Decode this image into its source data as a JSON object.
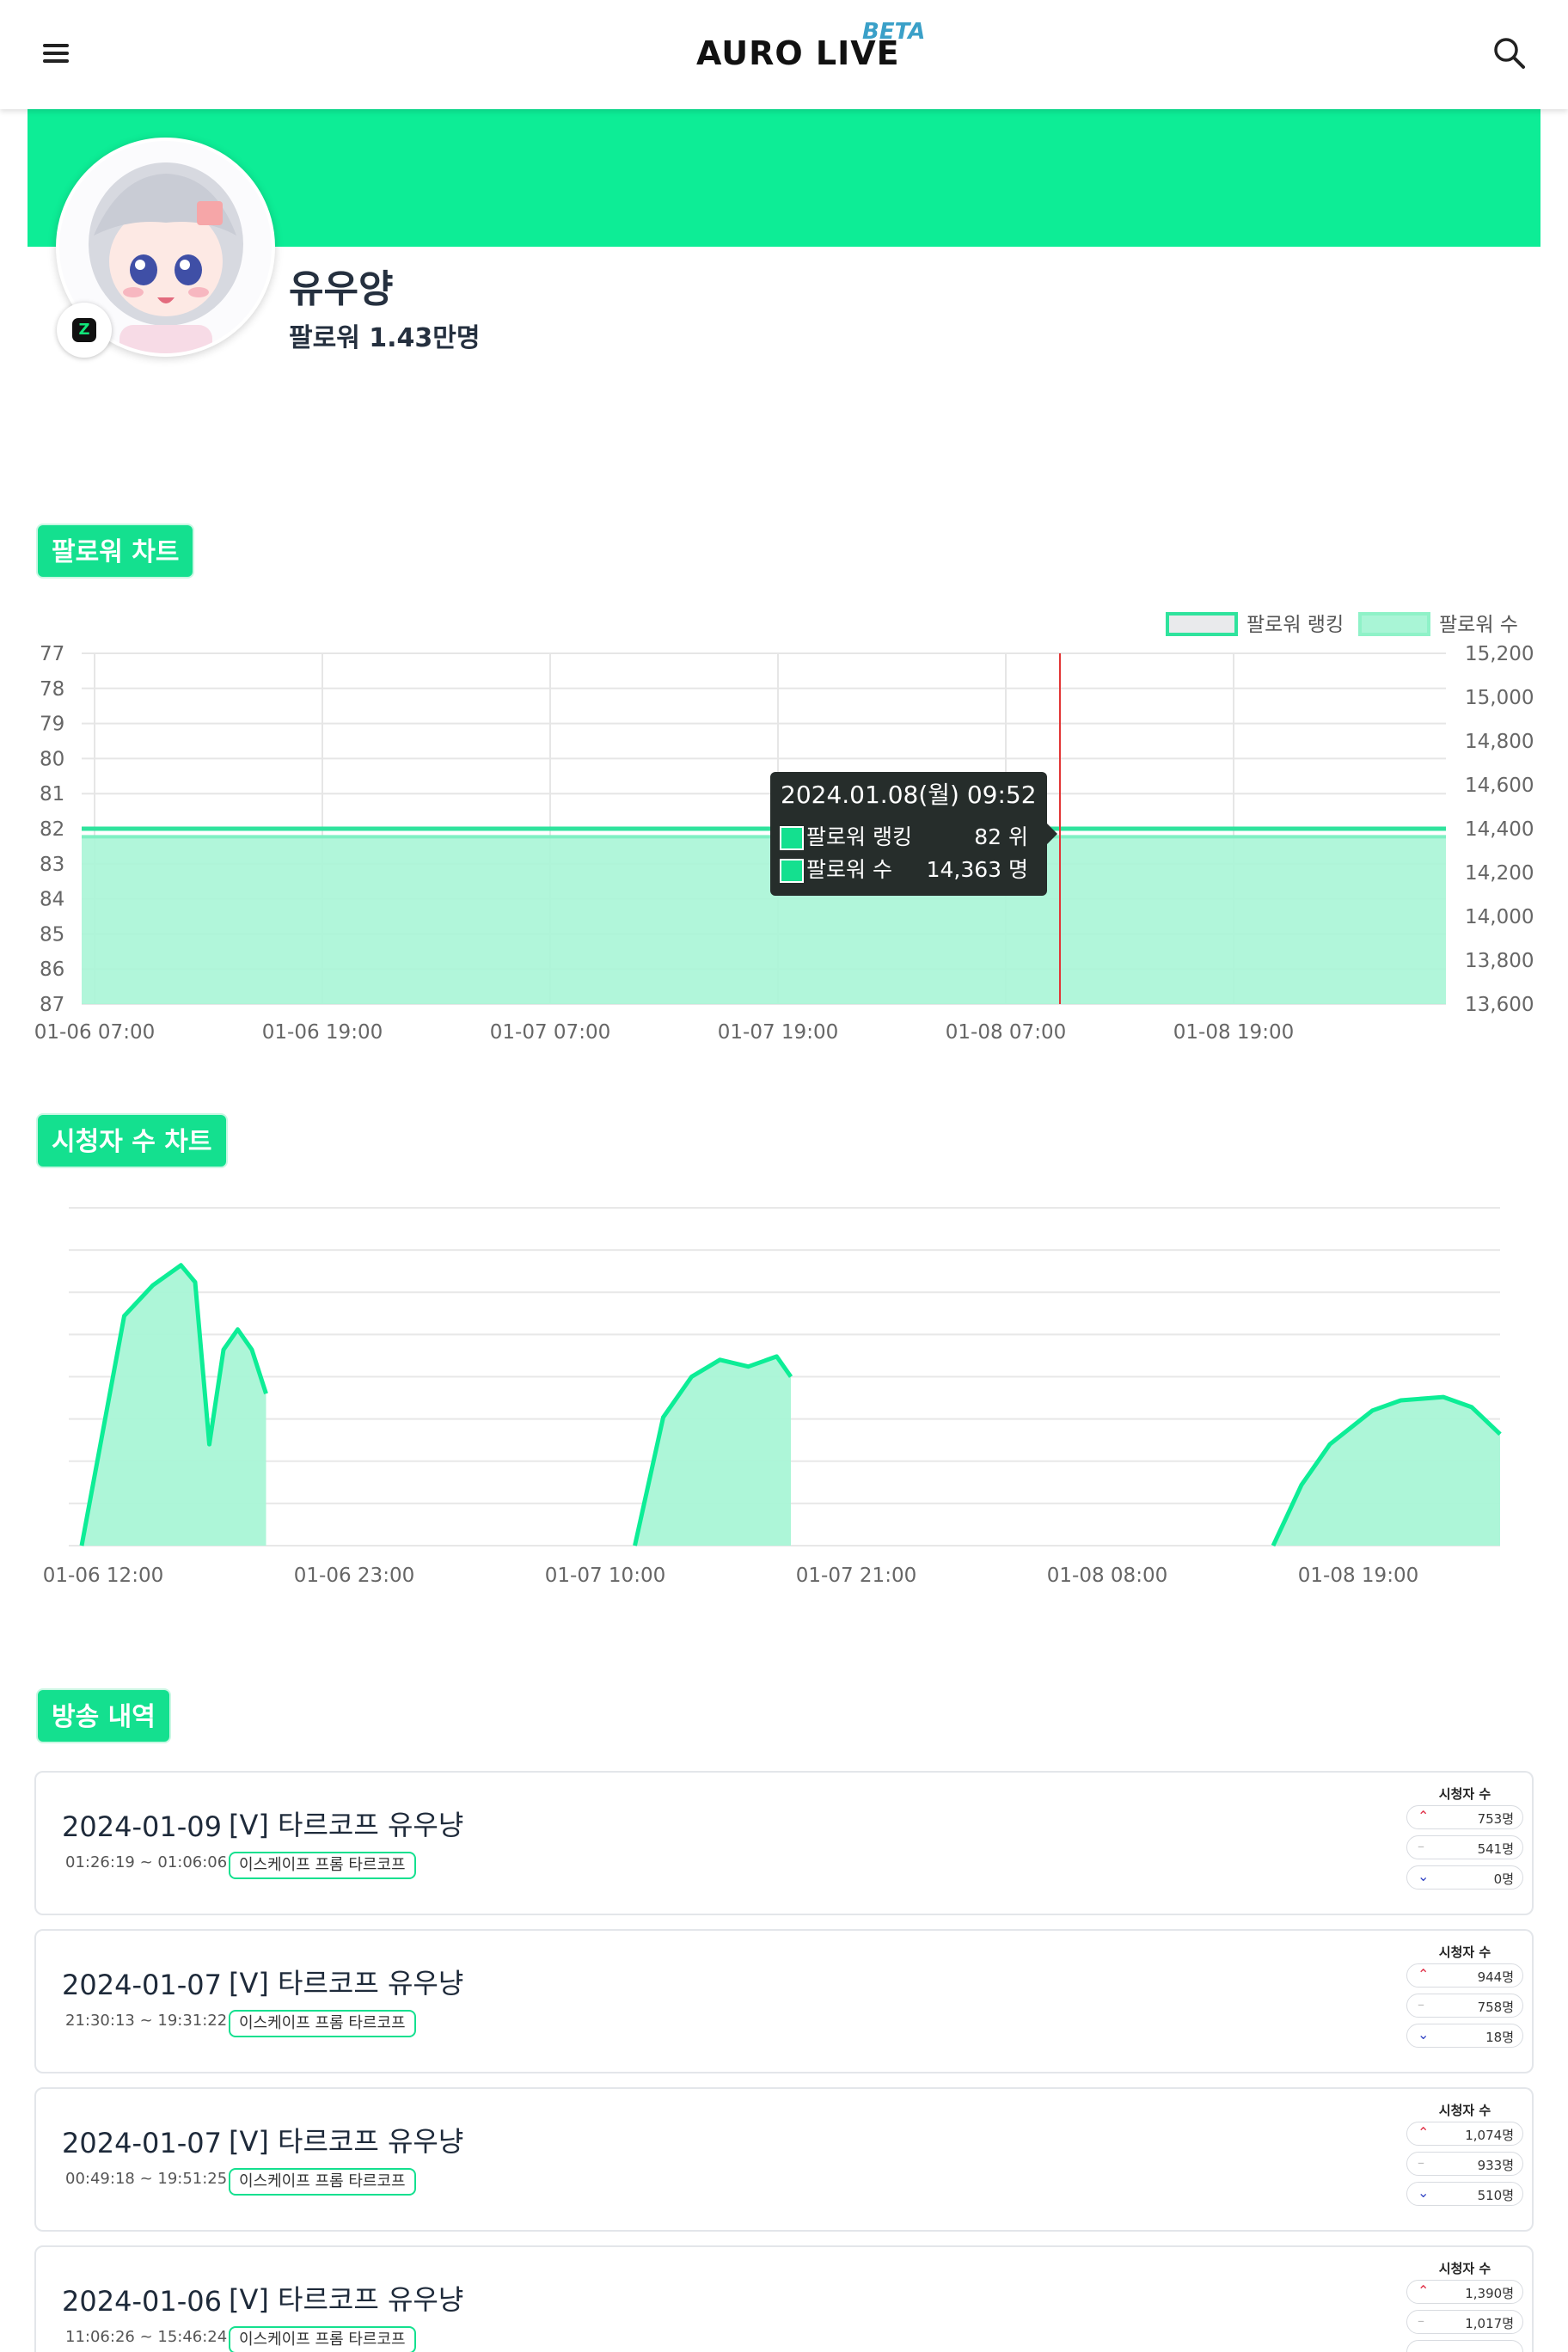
{
  "header": {
    "logo": "AURO LIVE",
    "logo_badge": "BETA",
    "menu_icon": "hamburger-menu-icon",
    "search_icon": "search-icon"
  },
  "profile": {
    "name": "유우양",
    "followers": "팔로워 1.43만명",
    "platform_icon": "chzzk-icon",
    "banner_color": "#0ded96"
  },
  "sections": {
    "follower_chart": "팔로워 차트",
    "viewer_chart": "시청자 수 차트",
    "broadcast_history": "방송 내역"
  },
  "follower_chart": {
    "legend": [
      "팔로워 랭킹",
      "팔로워 수"
    ],
    "tooltip": {
      "title": "2024.01.08(월) 09:52",
      "rows": [
        {
          "label": "팔로워 랭킹",
          "value": "82 위"
        },
        {
          "label": "팔로워 수",
          "value": "14,363 명"
        }
      ]
    }
  },
  "chart_data": [
    {
      "type": "line",
      "title": "",
      "x": [
        "01-06 07:00",
        "01-06 19:00",
        "01-07 07:00",
        "01-07 19:00",
        "01-08 07:00",
        "01-08 19:00"
      ],
      "left_axis_ticks": [
        "77",
        "78",
        "79",
        "80",
        "81",
        "82",
        "83",
        "84",
        "85",
        "86",
        "87"
      ],
      "right_axis_ticks": [
        "15,200",
        "15,000",
        "14,800",
        "14,600",
        "14,400",
        "14,200",
        "14,000",
        "13,800",
        "13,600"
      ],
      "left_axis_range": [
        77,
        87
      ],
      "left_axis_reversed": true,
      "right_axis_range": [
        13600,
        15200
      ],
      "series": [
        {
          "name": "팔로워 랭킹",
          "values": [
            82,
            82,
            82,
            82,
            82,
            82,
            82
          ],
          "color": "#0ded96"
        },
        {
          "name": "팔로워 수",
          "values": [
            14363,
            14363,
            14363,
            14363,
            14363,
            14363,
            14363
          ],
          "color": "#a9f5d6"
        }
      ],
      "cursor_x": "2024.01.08 09:52",
      "legend_position": "top-right",
      "grid": true
    },
    {
      "type": "area",
      "title": "",
      "x_ticks": [
        "01-06 12:00",
        "01-06 23:00",
        "01-07 10:00",
        "01-07 21:00",
        "01-08 08:00",
        "01-08 19:00"
      ],
      "series": [
        {
          "name": "",
          "color": "#0ded96",
          "segments": [
            {
              "points": [
                [
                  0.0,
                  0.0
                ],
                [
                  0.03,
                  0.68
                ],
                [
                  0.05,
                  0.77
                ],
                [
                  0.07,
                  0.83
                ],
                [
                  0.08,
                  0.78
                ],
                [
                  0.09,
                  0.3
                ],
                [
                  0.1,
                  0.58
                ],
                [
                  0.11,
                  0.64
                ],
                [
                  0.12,
                  0.58
                ],
                [
                  0.13,
                  0.45
                ]
              ]
            },
            {
              "points": [
                [
                  0.39,
                  0.0
                ],
                [
                  0.41,
                  0.38
                ],
                [
                  0.43,
                  0.5
                ],
                [
                  0.45,
                  0.55
                ],
                [
                  0.47,
                  0.53
                ],
                [
                  0.49,
                  0.56
                ],
                [
                  0.5,
                  0.5
                ]
              ]
            },
            {
              "points": [
                [
                  0.84,
                  0.0
                ],
                [
                  0.86,
                  0.18
                ],
                [
                  0.88,
                  0.3
                ],
                [
                  0.91,
                  0.4
                ],
                [
                  0.93,
                  0.43
                ],
                [
                  0.96,
                  0.44
                ],
                [
                  0.98,
                  0.41
                ],
                [
                  1.0,
                  0.33
                ]
              ]
            }
          ]
        }
      ],
      "grid": true
    }
  ],
  "broadcasts": {
    "viewer_header": "시청자 수",
    "items": [
      {
        "date": "2024-01-09",
        "time": "01:26:19 ~ 01:06:06",
        "title": "[V] 타르코프 유우냥",
        "tag": "이스케이프 프롬 타르코프",
        "max": "753명",
        "avg": "541명",
        "min": "0명"
      },
      {
        "date": "2024-01-07",
        "time": "21:30:13 ~ 19:31:22",
        "title": "[V] 타르코프 유우냥",
        "tag": "이스케이프 프롬 타르코프",
        "max": "944명",
        "avg": "758명",
        "min": "18명"
      },
      {
        "date": "2024-01-07",
        "time": "00:49:18 ~ 19:51:25",
        "title": "[V] 타르코프 유우냥",
        "tag": "이스케이프 프롬 타르코프",
        "max": "1,074명",
        "avg": "933명",
        "min": "510명"
      },
      {
        "date": "2024-01-06",
        "time": "11:06:26 ~ 15:46:24",
        "title": "[V] 타르코프 유우냥",
        "tag": "이스케이프 프롬 타르코프",
        "max": "1,390명",
        "avg": "1,017명",
        "min": ""
      }
    ]
  }
}
